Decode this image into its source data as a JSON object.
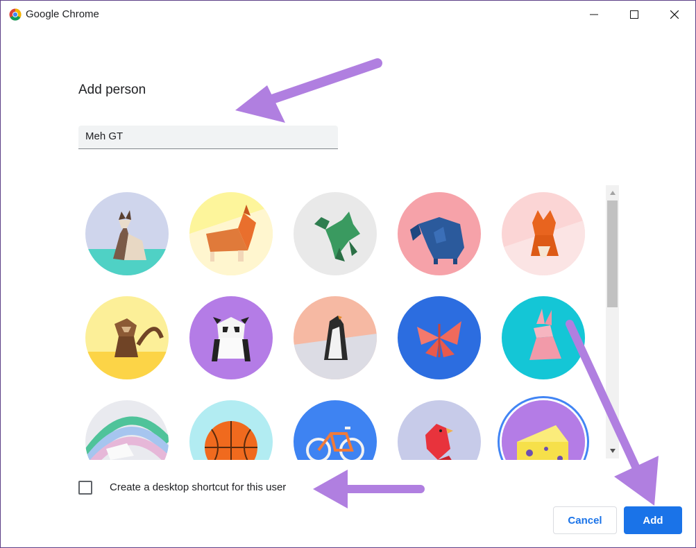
{
  "window": {
    "title": "Google Chrome",
    "icon": "chrome-icon",
    "controls": [
      "minimize-icon",
      "maximize-icon",
      "close-icon"
    ]
  },
  "dialog": {
    "heading": "Add person",
    "name_value": "Meh GT"
  },
  "avatars": [
    {
      "name": "origami-cat",
      "selected": false
    },
    {
      "name": "origami-corgi",
      "selected": false
    },
    {
      "name": "origami-dragon",
      "selected": false
    },
    {
      "name": "origami-elephant",
      "selected": false
    },
    {
      "name": "origami-fox",
      "selected": false
    },
    {
      "name": "origami-monkey",
      "selected": false
    },
    {
      "name": "origami-panda",
      "selected": false
    },
    {
      "name": "origami-penguin",
      "selected": false
    },
    {
      "name": "origami-butterfly",
      "selected": false
    },
    {
      "name": "origami-rabbit",
      "selected": false
    },
    {
      "name": "origami-unicorn",
      "selected": false
    },
    {
      "name": "basketball",
      "selected": false
    },
    {
      "name": "bicycle",
      "selected": false
    },
    {
      "name": "bird",
      "selected": false
    },
    {
      "name": "cheese",
      "selected": true
    }
  ],
  "shortcut": {
    "label": "Create a desktop shortcut for this user",
    "checked": false
  },
  "buttons": {
    "cancel": "Cancel",
    "add": "Add"
  },
  "colors": {
    "accent": "#1a73e8",
    "annotation_arrow": "#b07fe0",
    "selected_ring": "#4285f4"
  }
}
